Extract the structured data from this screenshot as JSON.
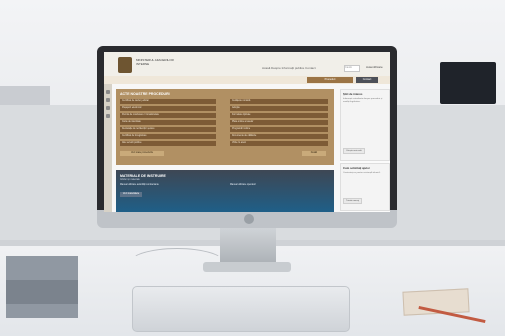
{
  "site": {
    "logo_text": "MINISTERUL AFACERILOR INTERNE",
    "nav": "Acasă  Despre  Informații publice  Contact",
    "search_placeholder": "Caută",
    "login_label": "Autentificare"
  },
  "tabs": [
    {
      "label": "Proceduri"
    },
    {
      "label": "Contact"
    }
  ],
  "procedures_panel": {
    "title": "ACTE NOASTRE PROCEDURI",
    "items_left": [
      "Certificat de cazier judiciar",
      "Pașaport electronic",
      "Permis de conducere / înmatriculare",
      "Carte de identitate",
      "Declarație de rezidență / ședere",
      "Certificat de înregistrare",
      "Alte servicii publice"
    ],
    "items_right": [
      "Cetățenie română",
      "Adopție",
      "Formulare tipizate",
      "Plata online a taxelor",
      "Programări online",
      "Documente de călătorie",
      "Vizite în arest"
    ],
    "more_left": "Vezi toate procedurile",
    "more_right": "Detalii"
  },
  "materials_panel": {
    "title": "MATERIALE DE INSTRUIRE",
    "subtitle": "Ghiduri și materiale",
    "item_left": "Manual utilizare autorități contractante",
    "item_right": "Manual utilizare operatori",
    "button": "Vezi materialele"
  },
  "right_cards": [
    {
      "title": "Știri de interes",
      "text": "Informații actualizate despre proceduri și noutăți legislative.",
      "button": "Citește mai mult"
    },
    {
      "title": "Cum solicitați ajutor",
      "text": "Contactați-ne pentru asistență tehnică.",
      "button": "Trimite mesaj"
    }
  ],
  "colors": {
    "procedures_bg": "#b19063",
    "procedure_item": "#7d5b36",
    "materials_bg": "#1f5f88",
    "accent": "#9b7445"
  }
}
